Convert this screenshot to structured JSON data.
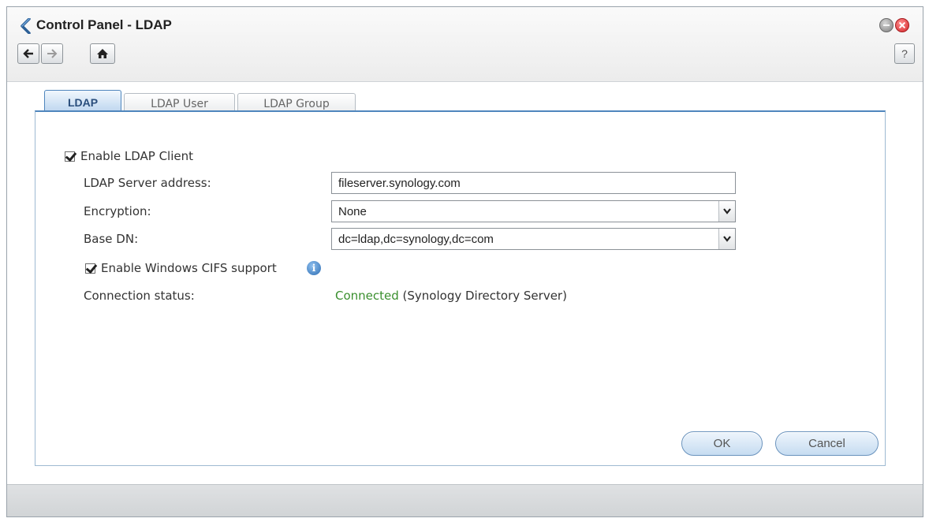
{
  "window": {
    "title": "Control Panel - LDAP",
    "help_label": "?"
  },
  "tabs": [
    {
      "label": "LDAP",
      "active": true
    },
    {
      "label": "LDAP User",
      "active": false
    },
    {
      "label": "LDAP Group",
      "active": false
    }
  ],
  "form": {
    "enable_ldap_client": {
      "label": "Enable LDAP Client",
      "checked": true
    },
    "server_address": {
      "label": "LDAP Server address:",
      "value": "fileserver.synology.com"
    },
    "encryption": {
      "label": "Encryption:",
      "value": "None"
    },
    "base_dn": {
      "label": "Base DN:",
      "value": "dc=ldap,dc=synology,dc=com"
    },
    "enable_cifs": {
      "label": "Enable Windows CIFS support",
      "checked": true,
      "info_glyph": "i"
    },
    "connection_status": {
      "label": "Connection status:",
      "status": "Connected",
      "detail": " (Synology Directory Server)"
    }
  },
  "buttons": {
    "ok": "OK",
    "cancel": "Cancel"
  },
  "colors": {
    "status_connected": "#3a8f2e",
    "accent": "#4f86bd",
    "close_red": "#d4262a"
  },
  "icons": [
    "synology-logo-icon",
    "minimize-icon",
    "close-icon",
    "back-arrow-icon",
    "forward-arrow-icon",
    "home-icon",
    "help-icon",
    "checkbox-checked-icon",
    "info-icon",
    "dropdown-arrow-icon"
  ]
}
